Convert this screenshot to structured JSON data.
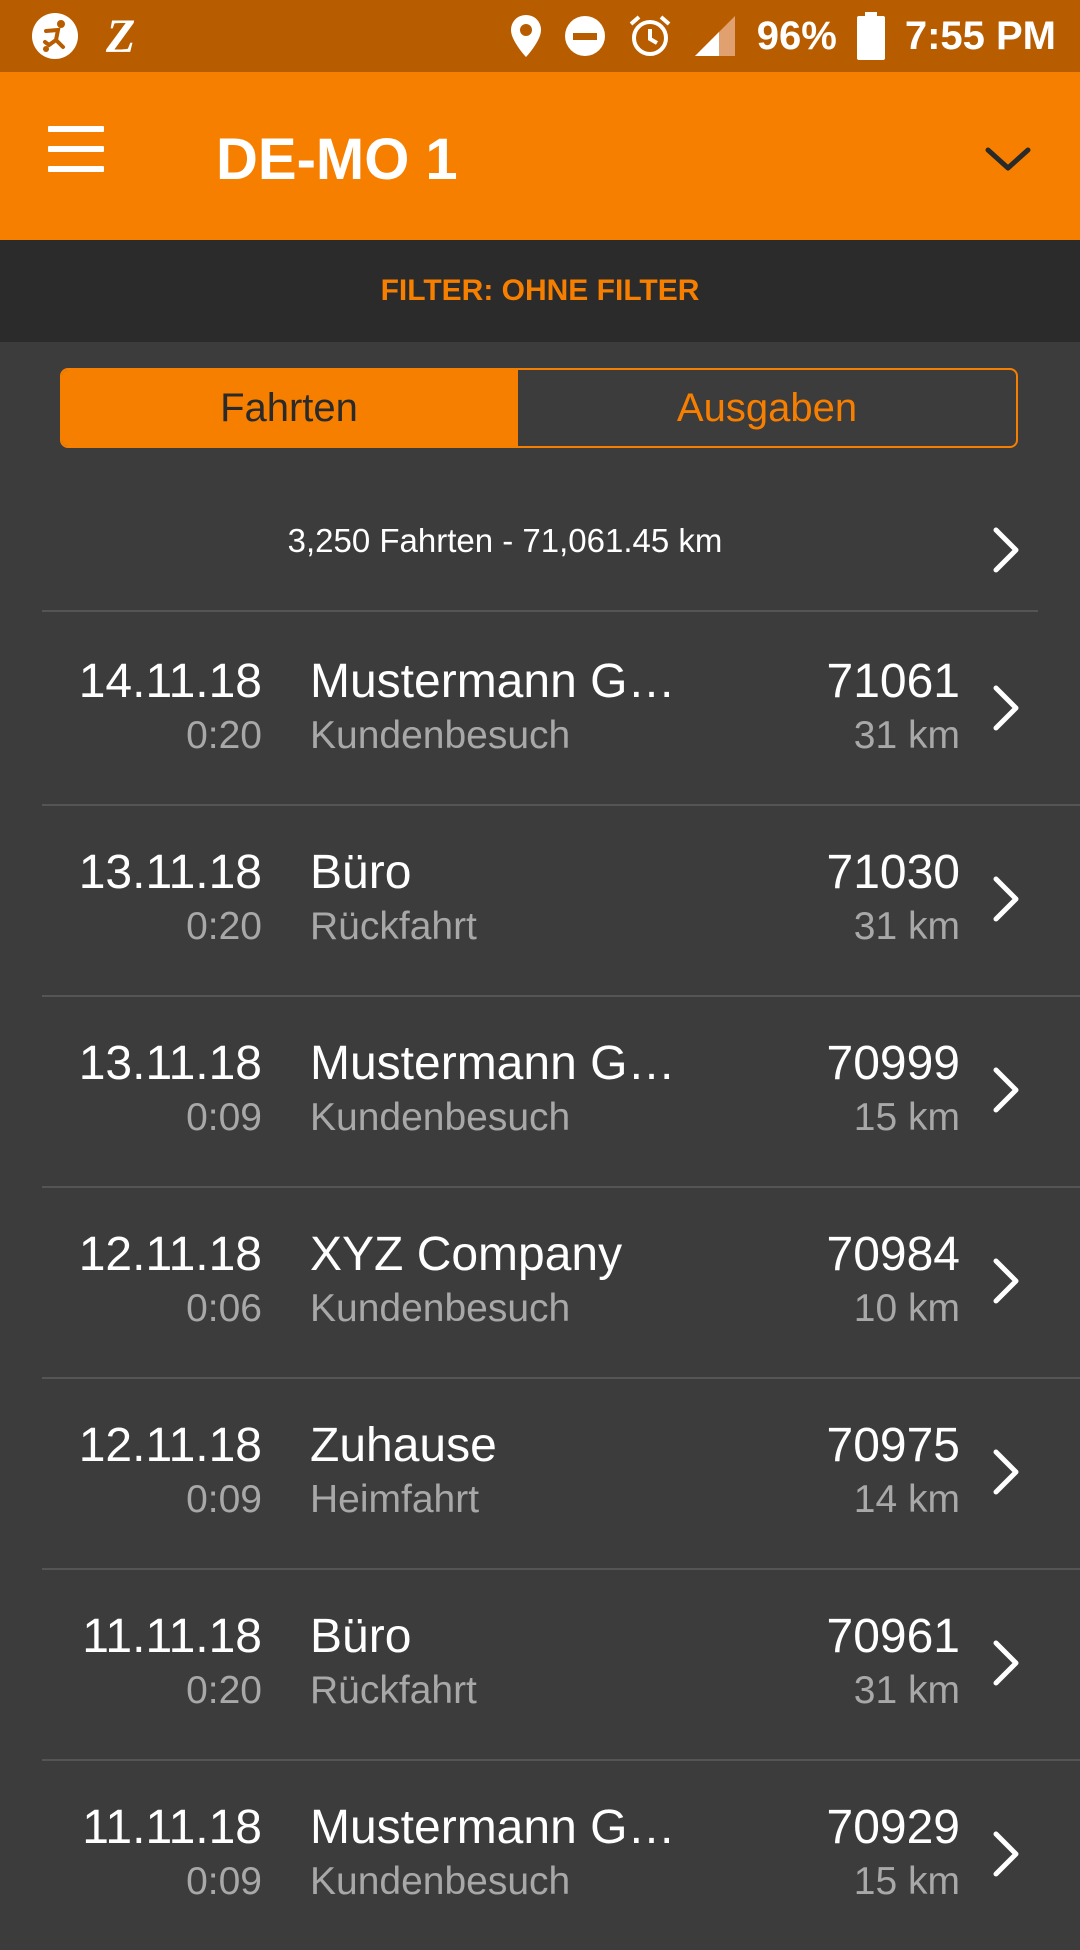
{
  "status_bar": {
    "battery": "96%",
    "time": "7:55 PM",
    "icons": [
      "soccer-player-icon",
      "z-app-icon",
      "location-icon",
      "do-not-disturb-icon",
      "alarm-icon",
      "signal-icon",
      "battery-icon"
    ]
  },
  "app_bar": {
    "title": "DE-MO 1",
    "menu_icon": "hamburger-menu-icon",
    "dropdown_icon": "chevron-down-icon"
  },
  "filter": {
    "label": "FILTER: OHNE FILTER"
  },
  "tabs": [
    {
      "label": "Fahrten",
      "selected": true
    },
    {
      "label": "Ausgaben",
      "selected": false
    }
  ],
  "summary": {
    "text": "3,250 Fahrten - 71,061.45 km"
  },
  "trips": [
    {
      "date": "14.11.18",
      "duration": "0:20",
      "destination": "Mustermann G…",
      "purpose": "Kundenbesuch",
      "odometer": "71061",
      "distance": "31 km"
    },
    {
      "date": "13.11.18",
      "duration": "0:20",
      "destination": "Büro",
      "purpose": "Rückfahrt",
      "odometer": "71030",
      "distance": "31 km"
    },
    {
      "date": "13.11.18",
      "duration": "0:09",
      "destination": "Mustermann G…",
      "purpose": "Kundenbesuch",
      "odometer": "70999",
      "distance": "15 km"
    },
    {
      "date": "12.11.18",
      "duration": "0:06",
      "destination": "XYZ Company",
      "purpose": "Kundenbesuch",
      "odometer": "70984",
      "distance": "10 km"
    },
    {
      "date": "12.11.18",
      "duration": "0:09",
      "destination": "Zuhause",
      "purpose": "Heimfahrt",
      "odometer": "70975",
      "distance": "14 km"
    },
    {
      "date": "11.11.18",
      "duration": "0:20",
      "destination": "Büro",
      "purpose": "Rückfahrt",
      "odometer": "70961",
      "distance": "31 km"
    },
    {
      "date": "11.11.18",
      "duration": "0:09",
      "destination": "Mustermann G…",
      "purpose": "Kundenbesuch",
      "odometer": "70929",
      "distance": "15 km"
    }
  ],
  "colors": {
    "accent": "#f77f00",
    "status_bar": "#b85c00",
    "background": "#3c3c3c",
    "filter_bar": "#2b2b2b",
    "secondary_text": "#a8a8a8"
  }
}
